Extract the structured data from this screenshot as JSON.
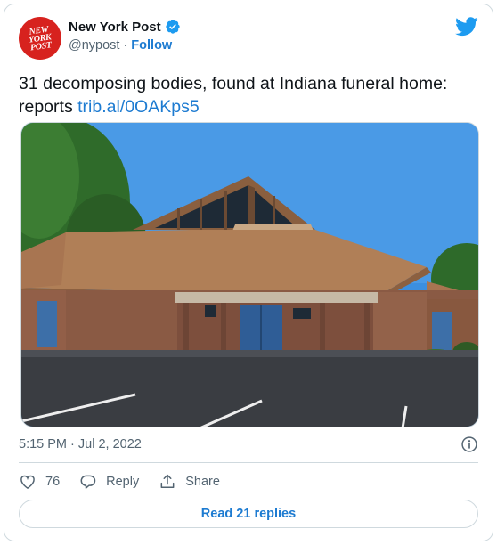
{
  "account": {
    "display_name": "New York Post",
    "handle": "@nypost",
    "separator": "·",
    "follow_label": "Follow",
    "avatar_logo": [
      "NEW",
      "YORK",
      "POST"
    ],
    "verified": true
  },
  "tweet": {
    "text": "31 decomposing bodies, found at Indiana funeral home: reports ",
    "link": "trib.al/0OAKps5",
    "timestamp": "5:15 PM · Jul 2, 2022"
  },
  "actions": {
    "like_count": "76",
    "reply_label": "Reply",
    "share_label": "Share",
    "read_replies_label": "Read 21 replies"
  },
  "icons": [
    "twitter-bird-icon",
    "verified-badge-icon",
    "info-icon",
    "heart-icon",
    "reply-icon",
    "share-icon"
  ],
  "colors": {
    "accent": "#1d7bd1",
    "twitter_blue": "#1d9bf0",
    "avatar_red": "#d7221e",
    "muted_text": "#536471",
    "border": "#cfd9de"
  }
}
